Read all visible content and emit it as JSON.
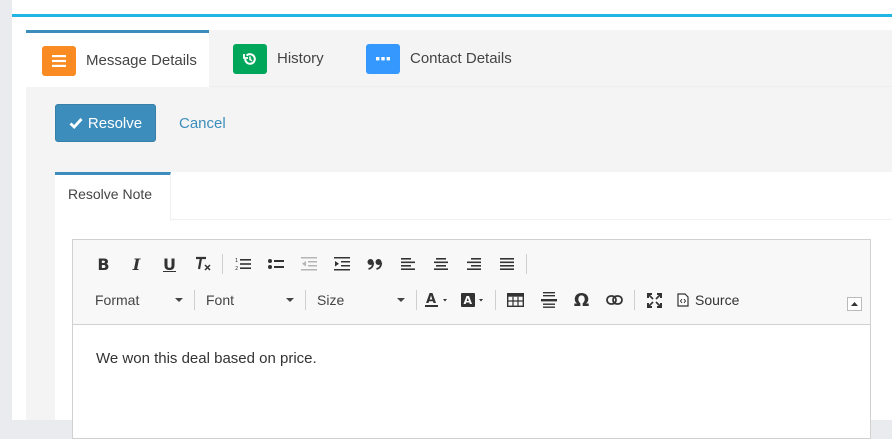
{
  "tabs": [
    {
      "label": "Message Details",
      "icon": "list-icon",
      "color": "#f98b22"
    },
    {
      "label": "History",
      "icon": "history-icon",
      "color": "#00a65a"
    },
    {
      "label": "Contact Details",
      "icon": "more-icon",
      "color": "#3498ff"
    }
  ],
  "actions": {
    "resolve_label": "Resolve",
    "cancel_label": "Cancel"
  },
  "note": {
    "tab_label": "Resolve Note"
  },
  "editor": {
    "format_label": "Format",
    "font_label": "Font",
    "size_label": "Size",
    "source_label": "Source",
    "content": "We won this deal based on price."
  },
  "colors": {
    "accent": "#3c8dbc",
    "top_bar": "#1fb5e4"
  }
}
